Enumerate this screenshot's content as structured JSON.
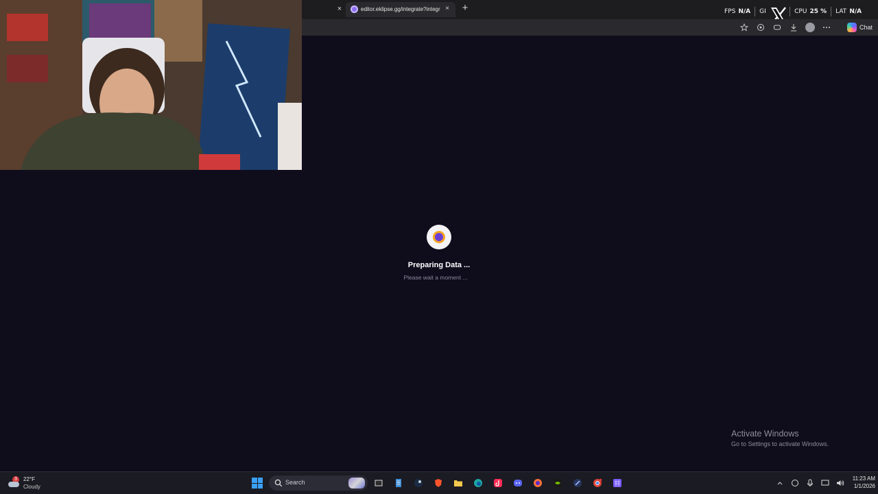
{
  "browser": {
    "tabs": [
      {
        "title": "",
        "active": false
      },
      {
        "title": "editor.eklipse.gg/integrate?integr",
        "active": true
      }
    ],
    "close_glyph": "×",
    "new_tab_glyph": "+",
    "chat_label": "Chat",
    "toolbar_icons": [
      "star-icon",
      "extensions-icon",
      "copilot-icon",
      "downloads-icon",
      "profile-icon",
      "more-icon"
    ]
  },
  "overlay_stats": [
    {
      "key": "FPS",
      "value": "N/A"
    },
    {
      "key": "GI",
      "value": ""
    },
    {
      "key": "CPU",
      "value": "25 %"
    },
    {
      "key": "LAT",
      "value": "N/A"
    }
  ],
  "loader": {
    "title": "Preparing Data ...",
    "subtitle": "Please wait a moment ..."
  },
  "watermark": {
    "title": "Activate Windows",
    "subtitle": "Go to Settings to activate Windows."
  },
  "taskbar": {
    "weather": {
      "badge": "3",
      "temp": "22°F",
      "condition": "Cloudy"
    },
    "search_label": "Search",
    "apps": [
      "file-explorer-icon",
      "notepad-icon",
      "steam-icon",
      "brave-icon",
      "folder-icon",
      "edge-icon",
      "tiktok-icon",
      "discord-icon",
      "firefox-icon",
      "nvidia-icon",
      "app-icon",
      "chrome-icon",
      "calendar-icon"
    ],
    "clock": {
      "time": "11:23 AM",
      "date": "1/1/2026"
    }
  },
  "colors": {
    "page_bg": "#0f0c1c",
    "accent": "#6b3fd6",
    "ring": "#f5a623"
  }
}
